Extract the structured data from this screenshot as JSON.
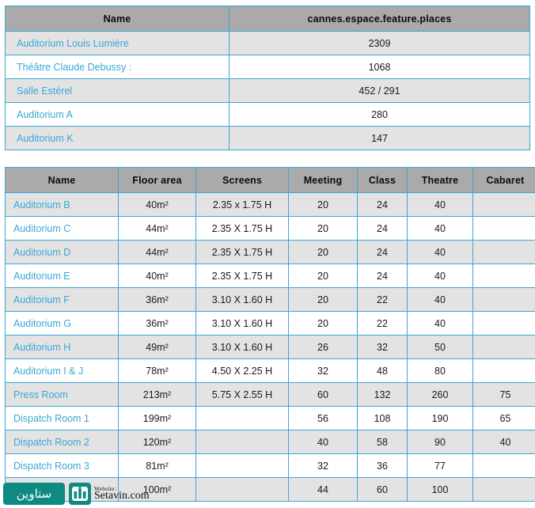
{
  "colors": {
    "border": "#3aa6d8",
    "header_bg": "#aaaaaa",
    "row_alt_bg": "#e3e3e3",
    "row_bg": "#ffffff",
    "name_text": "#3aa6d8",
    "value_text": "#1a1a1a",
    "watermark_teal": "#0d8b82"
  },
  "places_table": {
    "headers": [
      "Name",
      "cannes.espace.feature.places"
    ],
    "rows": [
      {
        "name": "Auditorium Louis Lumière",
        "places": "2309"
      },
      {
        "name": "Théâtre Claude Debussy :",
        "places": "1068"
      },
      {
        "name": "Salle Estérel",
        "places": "452 / 291"
      },
      {
        "name": "Auditorium A",
        "places": "280"
      },
      {
        "name": "Auditorium K",
        "places": "147"
      }
    ]
  },
  "rooms_table": {
    "headers": [
      "Name",
      "Floor area",
      "Screens",
      "Meeting",
      "Class",
      "Theatre",
      "Cabaret"
    ],
    "rows": [
      {
        "name": "Auditorium B",
        "floor_area": "40m²",
        "screens": "2.35 x 1.75 H",
        "meeting": "20",
        "class": "24",
        "theatre": "40",
        "cabaret": ""
      },
      {
        "name": "Auditorium C",
        "floor_area": "44m²",
        "screens": "2.35 X 1.75 H",
        "meeting": "20",
        "class": "24",
        "theatre": "40",
        "cabaret": ""
      },
      {
        "name": "Auditorium D",
        "floor_area": "44m²",
        "screens": "2.35 X 1.75 H",
        "meeting": "20",
        "class": "24",
        "theatre": "40",
        "cabaret": ""
      },
      {
        "name": "Auditorium E",
        "floor_area": "40m²",
        "screens": "2.35 X 1.75 H",
        "meeting": "20",
        "class": "24",
        "theatre": "40",
        "cabaret": ""
      },
      {
        "name": "Auditorium F",
        "floor_area": "36m²",
        "screens": "3.10 X 1.60 H",
        "meeting": "20",
        "class": "22",
        "theatre": "40",
        "cabaret": ""
      },
      {
        "name": "Auditorium G",
        "floor_area": "36m²",
        "screens": "3.10 X 1.60 H",
        "meeting": "20",
        "class": "22",
        "theatre": "40",
        "cabaret": ""
      },
      {
        "name": "Auditorium H",
        "floor_area": "49m²",
        "screens": "3.10 X 1.60 H",
        "meeting": "26",
        "class": "32",
        "theatre": "50",
        "cabaret": ""
      },
      {
        "name": "Auditorium I & J",
        "floor_area": "78m²",
        "screens": "4.50 X 2.25 H",
        "meeting": "32",
        "class": "48",
        "theatre": "80",
        "cabaret": ""
      },
      {
        "name": "Press Room",
        "floor_area": "213m²",
        "screens": "5.75 X 2.55 H",
        "meeting": "60",
        "class": "132",
        "theatre": "260",
        "cabaret": "75"
      },
      {
        "name": "Dispatch Room 1",
        "floor_area": "199m²",
        "screens": "",
        "meeting": "56",
        "class": "108",
        "theatre": "190",
        "cabaret": "65"
      },
      {
        "name": "Dispatch Room 2",
        "floor_area": "120m²",
        "screens": "",
        "meeting": "40",
        "class": "58",
        "theatre": "90",
        "cabaret": "40"
      },
      {
        "name": "Dispatch Room 3",
        "floor_area": "81m²",
        "screens": "",
        "meeting": "32",
        "class": "36",
        "theatre": "77",
        "cabaret": ""
      },
      {
        "name": "",
        "floor_area": "100m²",
        "screens": "",
        "meeting": "44",
        "class": "60",
        "theatre": "100",
        "cabaret": ""
      }
    ]
  },
  "watermark": {
    "badge_text": "ستاوین",
    "label": "Website:",
    "site": "Setavin.com"
  }
}
